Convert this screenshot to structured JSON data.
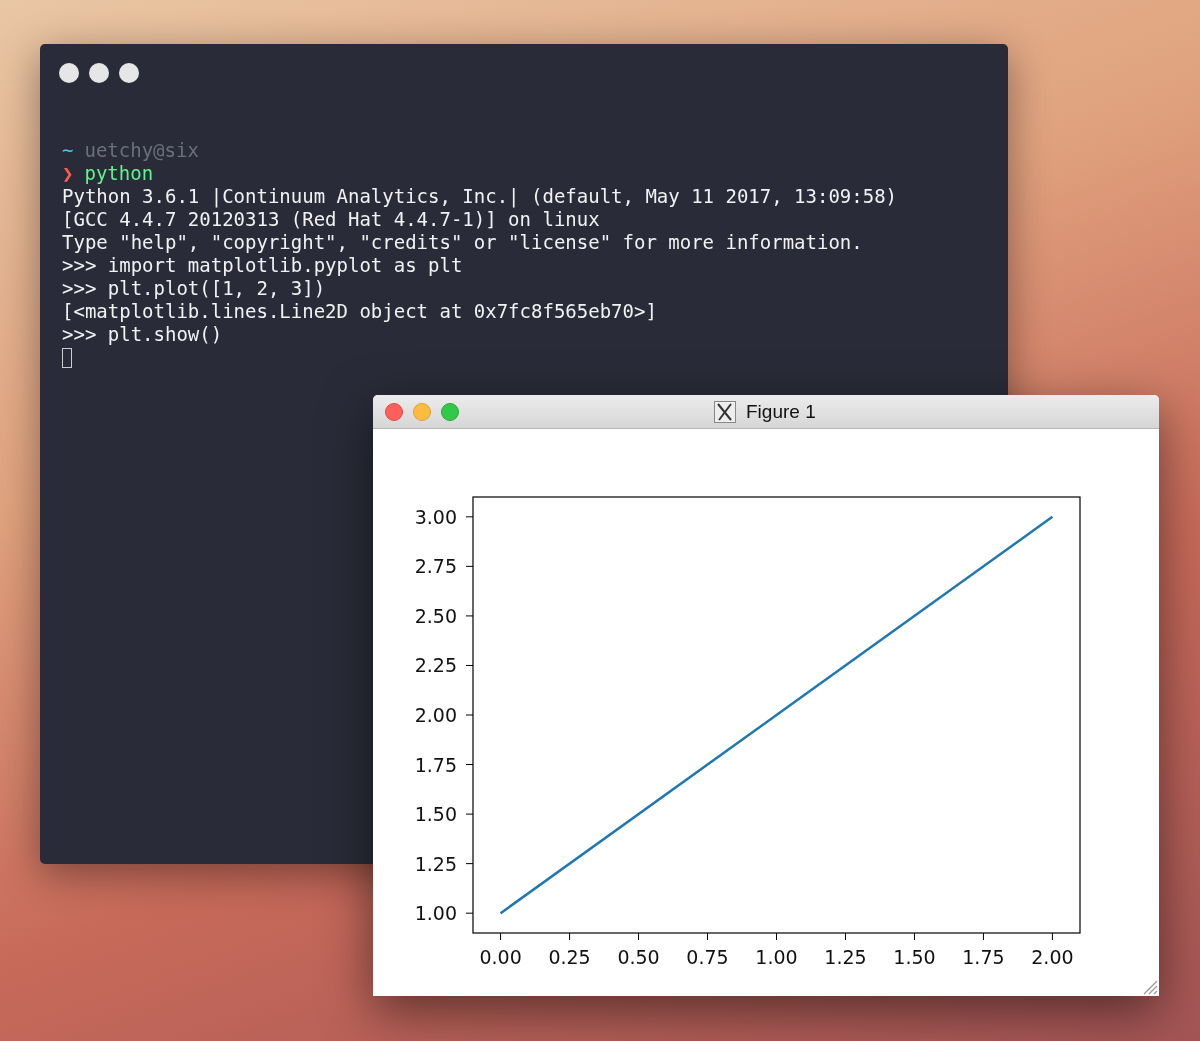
{
  "terminal": {
    "lines": [
      {
        "kind": "path",
        "symbol": "~",
        "text": "uetchy@six"
      },
      {
        "kind": "command",
        "symbol": "❯",
        "text": "python"
      },
      {
        "kind": "output",
        "text": "Python 3.6.1 |Continuum Analytics, Inc.| (default, May 11 2017, 13:09:58)"
      },
      {
        "kind": "output",
        "text": "[GCC 4.4.7 20120313 (Red Hat 4.4.7-1)] on linux"
      },
      {
        "kind": "output",
        "text": "Type \"help\", \"copyright\", \"credits\" or \"license\" for more information."
      },
      {
        "kind": "output",
        "text": ">>> import matplotlib.pyplot as plt"
      },
      {
        "kind": "output",
        "text": ">>> plt.plot([1, 2, 3])"
      },
      {
        "kind": "output",
        "text": "[<matplotlib.lines.Line2D object at 0x7fc8f565eb70>]"
      },
      {
        "kind": "output",
        "text": ">>> plt.show()"
      }
    ]
  },
  "figure_window": {
    "title": "Figure 1",
    "chart_data": {
      "type": "line",
      "x": [
        0,
        1,
        2
      ],
      "series": [
        {
          "color": "#1f77b4",
          "values": [
            1,
            2,
            3
          ]
        }
      ],
      "xlim": [
        -0.1,
        2.1
      ],
      "ylim": [
        0.9,
        3.1
      ],
      "xticks": [
        {
          "value": 0,
          "label": "0.00"
        },
        {
          "value": 0.25,
          "label": "0.25"
        },
        {
          "value": 0.5,
          "label": "0.50"
        },
        {
          "value": 0.75,
          "label": "0.75"
        },
        {
          "value": 1,
          "label": "1.00"
        },
        {
          "value": 1.25,
          "label": "1.25"
        },
        {
          "value": 1.5,
          "label": "1.50"
        },
        {
          "value": 1.75,
          "label": "1.75"
        },
        {
          "value": 2,
          "label": "2.00"
        }
      ],
      "yticks": [
        {
          "value": 1,
          "label": "1.00"
        },
        {
          "value": 1.25,
          "label": "1.25"
        },
        {
          "value": 1.5,
          "label": "1.50"
        },
        {
          "value": 1.75,
          "label": "1.75"
        },
        {
          "value": 2,
          "label": "2.00"
        },
        {
          "value": 2.25,
          "label": "2.25"
        },
        {
          "value": 2.5,
          "label": "2.50"
        },
        {
          "value": 2.75,
          "label": "2.75"
        },
        {
          "value": 3,
          "label": "3.00"
        }
      ]
    }
  }
}
